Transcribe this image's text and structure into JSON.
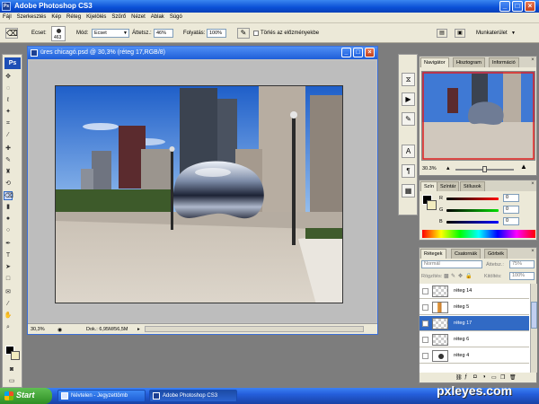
{
  "app": {
    "title": "Adobe Photoshop CS3"
  },
  "menu": [
    "Fájl",
    "Szerkesztés",
    "Kép",
    "Réteg",
    "Kijelölés",
    "Szűrő",
    "Nézet",
    "Ablak",
    "Súgó"
  ],
  "options": {
    "brush_label": "Ecset:",
    "brush_size": "463",
    "mode_label": "Mód:",
    "mode_value": "Ecset",
    "opacity_label": "Áttetsz.:",
    "opacity_value": "46%",
    "flow_label": "Folyatás:",
    "flow_value": "100%",
    "erase_history_label": "Törlés az előzményekbe",
    "workspace_label": "Munkaterület"
  },
  "document": {
    "title": "üres chicagó.psd @ 30,3% (réteg 17,RGB/8)",
    "zoom": "30,3%",
    "doc_size": "Dok.: 6,95M/56,5M"
  },
  "navigator": {
    "tabs": [
      "Navigátor",
      "Hisztogram",
      "Információ"
    ],
    "zoom": "30.3%"
  },
  "color": {
    "tabs": [
      "Szín",
      "Színtár",
      "Stílusok"
    ],
    "r_label": "R",
    "g_label": "G",
    "b_label": "B",
    "r": "0",
    "g": "0",
    "b": "0"
  },
  "layers": {
    "tabs": [
      "Rétegek",
      "Csatornák",
      "Görbék"
    ],
    "blend_mode": "Normál",
    "opacity_label": "Áttetsz.:",
    "opacity": "75%",
    "fill_label": "Kitöltés:",
    "fill": "100%",
    "lock_label": "Rögzítés:",
    "items": [
      {
        "name": "réteg 14"
      },
      {
        "name": "réteg 5"
      },
      {
        "name": "réteg 17"
      },
      {
        "name": "réteg 6"
      },
      {
        "name": "réteg 4"
      }
    ]
  },
  "taskbar": {
    "start": "Start",
    "items": [
      "Névtelen - Jegyzettömb",
      "Adobe Photoshop CS3"
    ]
  },
  "watermark": "pxleyes.com",
  "colors": {
    "xp_blue": "#245edb",
    "selection": "#316ac5",
    "panel_bg": "#ece9d8"
  }
}
